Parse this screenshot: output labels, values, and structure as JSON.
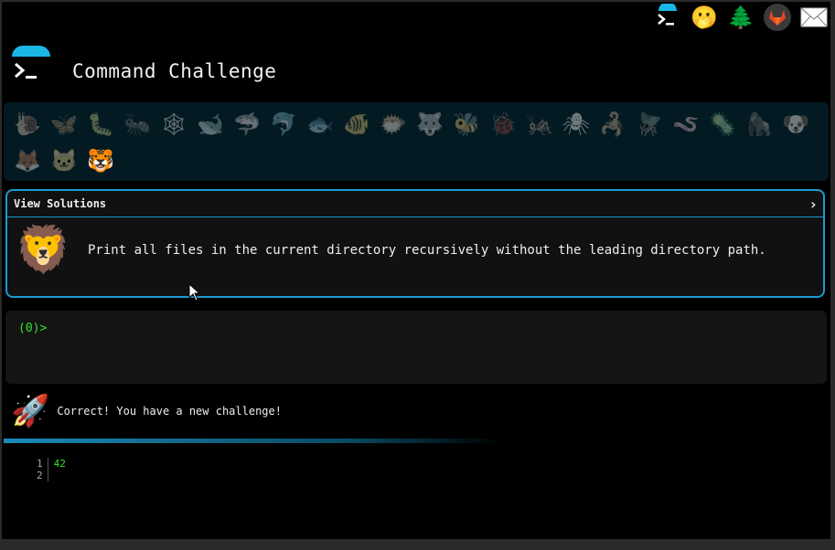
{
  "header": {
    "title": "Command Challenge"
  },
  "top_icons": [
    {
      "name": "terminal-logo-icon",
      "glyph": ""
    },
    {
      "name": "hushed-face-icon",
      "glyph": "🫢"
    },
    {
      "name": "tree-icon",
      "glyph": "🌲"
    },
    {
      "name": "gitlab-icon",
      "glyph": ""
    },
    {
      "name": "mail-icon",
      "glyph": "✉"
    }
  ],
  "animals": [
    {
      "name": "snail-icon",
      "glyph": "🐌"
    },
    {
      "name": "butterfly-icon",
      "glyph": "🦋"
    },
    {
      "name": "caterpillar-icon",
      "glyph": "🐛"
    },
    {
      "name": "ant-icon",
      "glyph": "🐜"
    },
    {
      "name": "spider-web-icon",
      "glyph": "🕸"
    },
    {
      "name": "whale-icon",
      "glyph": "🐋"
    },
    {
      "name": "shark-icon",
      "glyph": "🦈"
    },
    {
      "name": "dolphin-icon",
      "glyph": "🐬"
    },
    {
      "name": "fish-icon",
      "glyph": "🐟"
    },
    {
      "name": "tropical-fish-icon",
      "glyph": "🐠"
    },
    {
      "name": "blowfish-icon",
      "glyph": "🐡"
    },
    {
      "name": "wolf-icon",
      "glyph": "🐺"
    },
    {
      "name": "bee-icon",
      "glyph": "🐝"
    },
    {
      "name": "ladybug-icon",
      "glyph": "🐞"
    },
    {
      "name": "cricket-icon",
      "glyph": "🦗"
    },
    {
      "name": "spider-icon",
      "glyph": "🕷"
    },
    {
      "name": "scorpion-icon",
      "glyph": "🦂"
    },
    {
      "name": "fly-icon",
      "glyph": "🪰"
    },
    {
      "name": "worm-icon",
      "glyph": "🪱"
    },
    {
      "name": "microbe-icon",
      "glyph": "🦠"
    },
    {
      "name": "gorilla-icon",
      "glyph": "🦍"
    },
    {
      "name": "dog-icon",
      "glyph": "🐶"
    },
    {
      "name": "fox-icon",
      "glyph": "🦊"
    },
    {
      "name": "cat-icon",
      "glyph": "🐱"
    },
    {
      "name": "tiger-icon",
      "glyph": "🐯"
    }
  ],
  "challenge": {
    "view_solutions": "View Solutions",
    "chevron": "›",
    "lion": "🦁",
    "text": "Print all files in the current directory recursively without the leading directory path."
  },
  "terminal": {
    "prompt": "(0)>"
  },
  "result": {
    "rocket": "🚀",
    "message": "Correct! You have a new challenge!"
  },
  "progress": {
    "fraction": 0.6
  },
  "output": {
    "line_numbers": [
      "1",
      "2"
    ],
    "lines": [
      "42",
      ""
    ]
  }
}
